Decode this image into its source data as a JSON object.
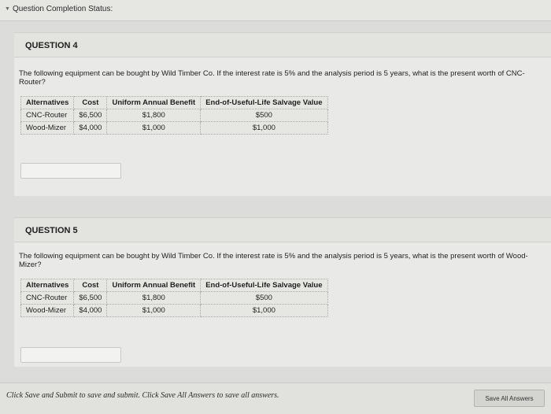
{
  "header": {
    "status_label": "Question Completion Status:"
  },
  "questions": [
    {
      "title": "QUESTION 4",
      "text": "The following equipment can be bought by Wild Timber Co. If the interest rate is 5% and the analysis period is 5 years, what is the present worth of CNC-Router?",
      "table": {
        "headers": [
          "Alternatives",
          "Cost",
          "Uniform Annual Benefit",
          "End-of-Useful-Life Salvage Value"
        ],
        "rows": [
          [
            "CNC-Router",
            "$6,500",
            "$1,800",
            "$500"
          ],
          [
            "Wood-Mizer",
            "$4,000",
            "$1,000",
            "$1,000"
          ]
        ]
      },
      "answer_value": ""
    },
    {
      "title": "QUESTION 5",
      "text": "The following equipment can be bought by Wild Timber Co. If the interest rate is 5% and the analysis period is 5 years, what is the present worth of Wood-Mizer?",
      "table": {
        "headers": [
          "Alternatives",
          "Cost",
          "Uniform Annual Benefit",
          "End-of-Useful-Life Salvage Value"
        ],
        "rows": [
          [
            "CNC-Router",
            "$6,500",
            "$1,800",
            "$500"
          ],
          [
            "Wood-Mizer",
            "$4,000",
            "$1,000",
            "$1,000"
          ]
        ]
      },
      "answer_value": ""
    }
  ],
  "footer": {
    "instruction": "Click Save and Submit to save and submit. Click Save All Answers to save all answers.",
    "save_all_label": "Save All Answers"
  }
}
